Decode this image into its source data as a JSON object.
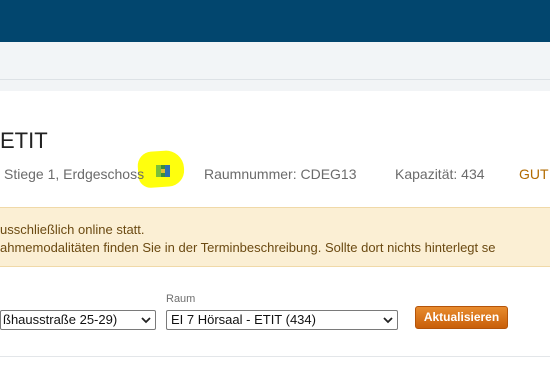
{
  "header": {
    "title": "ETIT"
  },
  "room_info": {
    "location": "Stiege 1, Erdgeschoss",
    "room_number": "Raumnummer: CDEG13",
    "capacity": "Kapazität: 434",
    "status": "GUT"
  },
  "notice": {
    "line1": "usschließlich online statt.",
    "line2": "ahmemodalitäten finden Sie in der Terminbeschreibung. Sollte dort nichts hinterlegt se"
  },
  "filters": {
    "building_value": "ßhausstraße 25-29)",
    "room_label": "Raum",
    "room_value": "EI 7 Hörsaal - ETIT (434)",
    "update_button": "Aktualisieren"
  },
  "colors": {
    "topbar": "#02466e",
    "notice_bg": "#fbefd4",
    "button": "#d9731a",
    "highlight": "#ffff00"
  },
  "icons": {
    "map": "map-icon",
    "dropdown": "chevron-down-icon"
  }
}
